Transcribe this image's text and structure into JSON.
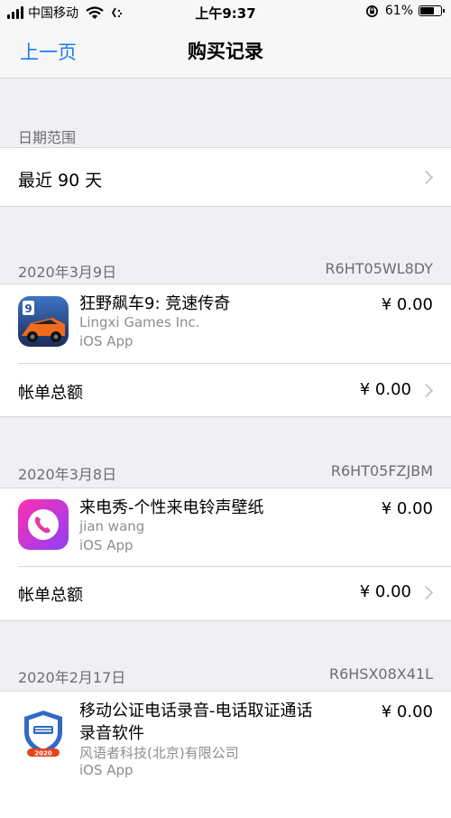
{
  "status_bar": {
    "carrier": "中国移动",
    "time": "上午9:37",
    "battery": "61%",
    "battery_level": 0.61
  },
  "nav": {
    "back": "上一页",
    "title": "购买记录"
  },
  "date_range": {
    "header": "日期范围",
    "value": "最近 90 天"
  },
  "purchases": [
    {
      "date": "2020年3月9日",
      "order_id": "R6HT05WL8DY",
      "app": {
        "name": "狂野飙车9: 竞速传奇",
        "developer": "Lingxi Games Inc.",
        "type": "iOS App",
        "price": "¥ 0.00",
        "icon": "asphalt-9-icon"
      },
      "total_label": "帐单总额",
      "total": "¥ 0.00"
    },
    {
      "date": "2020年3月8日",
      "order_id": "R6HT05FZJBM",
      "app": {
        "name": "来电秀-个性来电铃声壁纸",
        "developer": "jian wang",
        "type": "iOS App",
        "price": "¥ 0.00",
        "icon": "phone-call-show-icon"
      },
      "total_label": "帐单总额",
      "total": "¥ 0.00"
    },
    {
      "date": "2020年2月17日",
      "order_id": "R6HSX08X41L",
      "app": {
        "name": "移动公证电话录音-电话取证通话录音软件",
        "developer": "风语者科技(北京)有限公司",
        "type": "iOS App",
        "price": "¥ 0.00",
        "icon": "notary-recorder-icon",
        "badge": "2020"
      }
    }
  ]
}
